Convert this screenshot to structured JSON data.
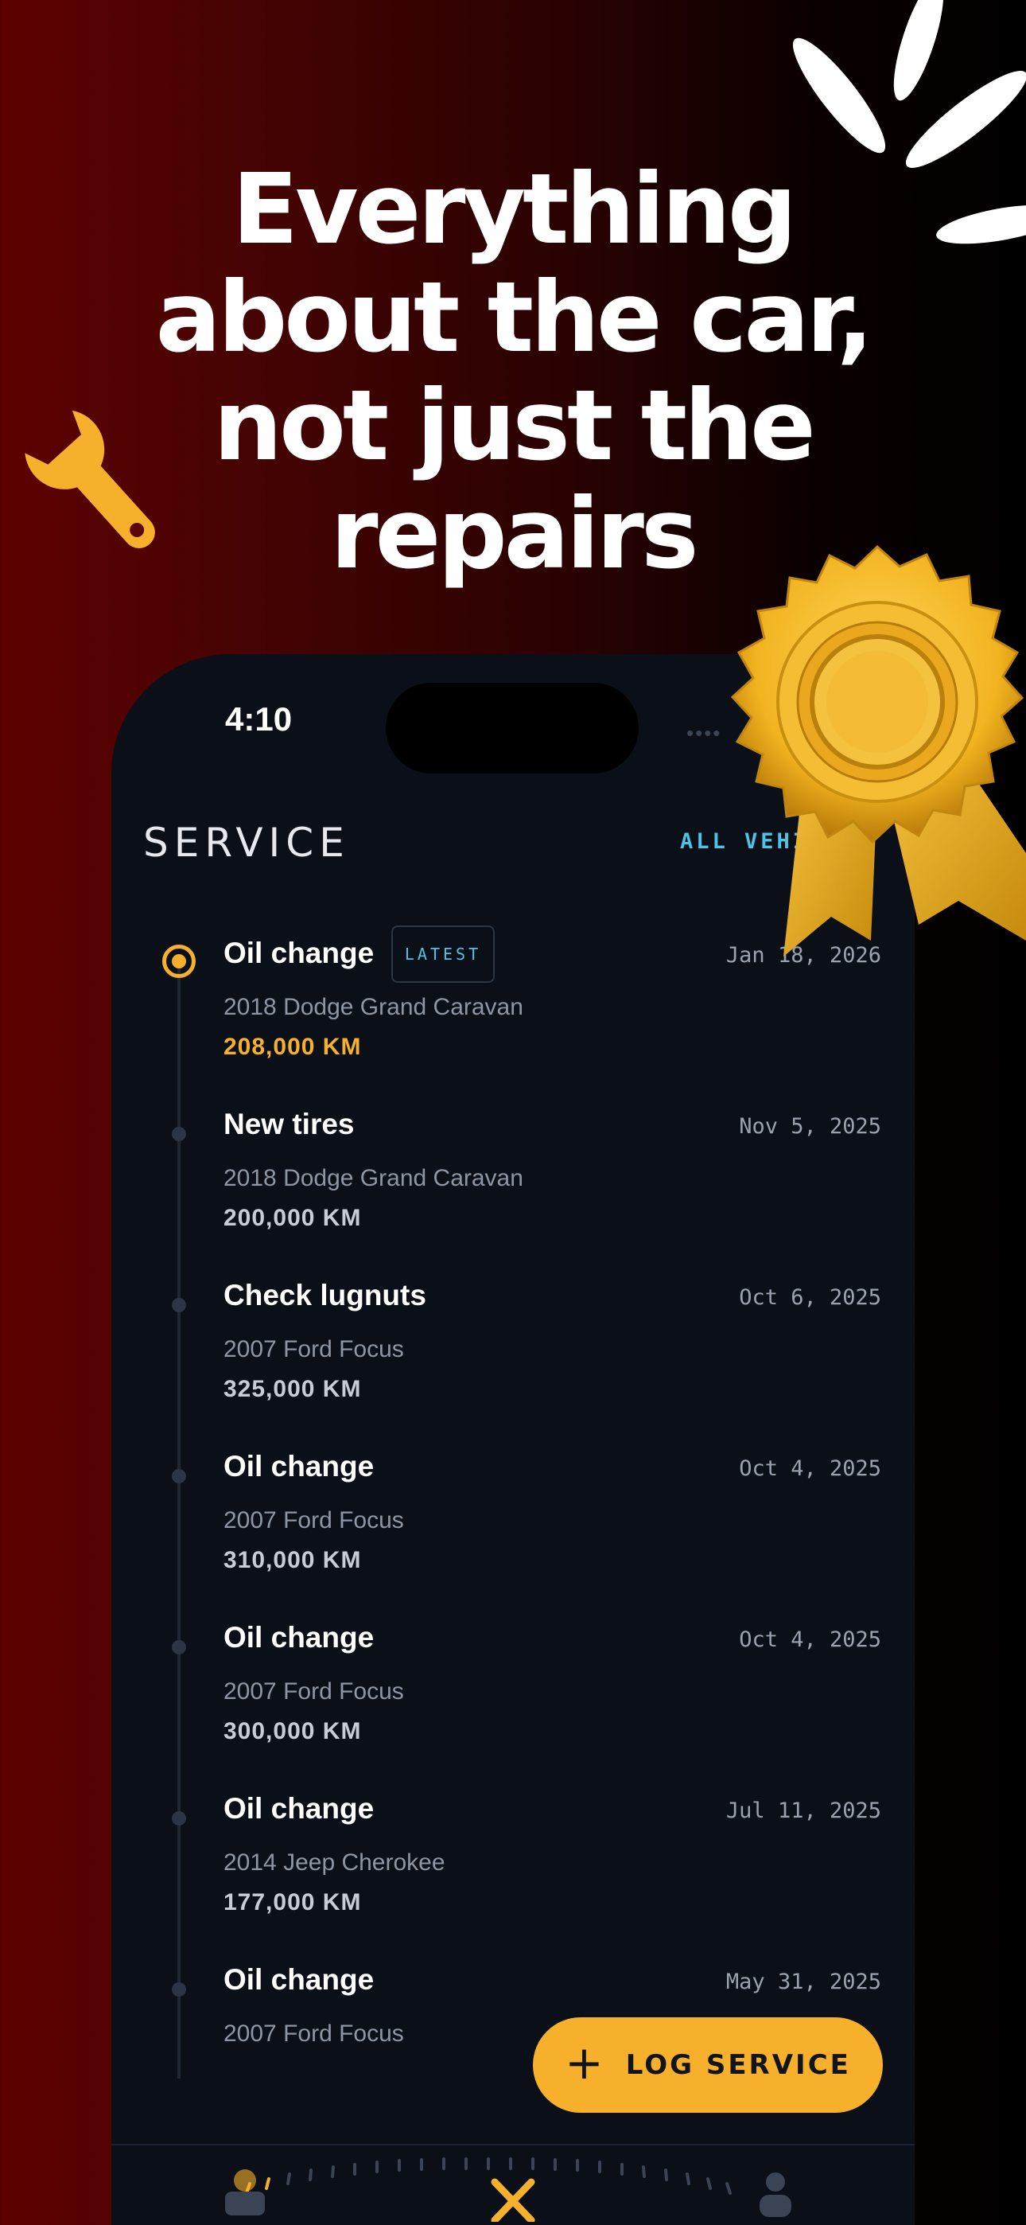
{
  "headline": {
    "line1": "Everything",
    "line2": "about the car,",
    "line3": "not just the",
    "line4": "repairs"
  },
  "status_bar": {
    "time": "4:10"
  },
  "header": {
    "title": "SERVICE",
    "link": "ALL VEHI"
  },
  "entries": [
    {
      "title": "Oil change",
      "badge": "LATEST",
      "vehicle": "2018 Dodge Grand Caravan",
      "km": "208,000 KM",
      "date": "Jan 18, 2026"
    },
    {
      "title": "New tires",
      "vehicle": "2018 Dodge Grand Caravan",
      "km": "200,000 KM",
      "date": "Nov 5, 2025"
    },
    {
      "title": "Check lugnuts",
      "vehicle": "2007 Ford Focus",
      "km": "325,000 KM",
      "date": "Oct 6, 2025"
    },
    {
      "title": "Oil change",
      "vehicle": "2007 Ford Focus",
      "km": "310,000 KM",
      "date": "Oct 4, 2025"
    },
    {
      "title": "Oil change",
      "vehicle": "2007 Ford Focus",
      "km": "300,000 KM",
      "date": "Oct 4, 2025"
    },
    {
      "title": "Oil change",
      "vehicle": "2014 Jeep Cherokee",
      "km": "177,000 KM",
      "date": "Jul 11, 2025"
    },
    {
      "title": "Oil change",
      "vehicle": "2007 Ford Focus",
      "km": "",
      "date": "May 31, 2025"
    }
  ],
  "fab": {
    "icon": "plus-icon",
    "label": "LOG SERVICE"
  },
  "tabbar": {
    "icons": [
      "car-icon",
      "tools-icon",
      "person-icon"
    ]
  },
  "colors": {
    "accent": "#f6b02c",
    "link": "#4fc3e3",
    "background": "#0b0f17"
  }
}
